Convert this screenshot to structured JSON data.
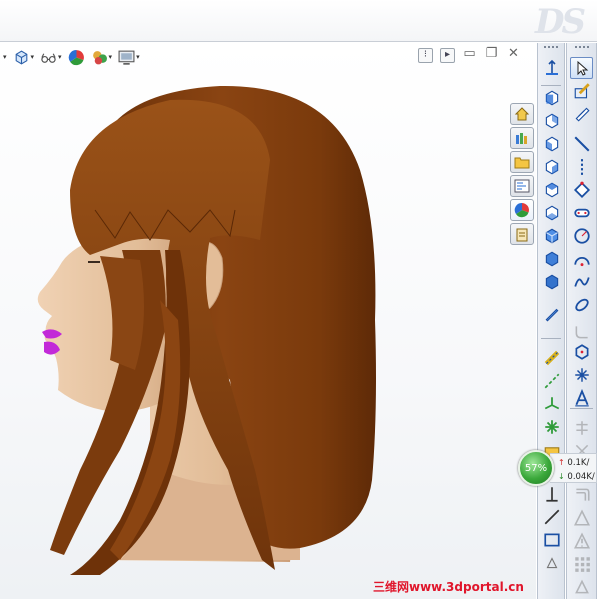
{
  "app": {
    "logo_text": "DS"
  },
  "hud_toolbar": {
    "buttons": [
      {
        "name": "view-orientation",
        "icon": "cube-icon"
      },
      {
        "name": "hide-show-items",
        "icon": "glasses-icon"
      },
      {
        "name": "edit-appearance",
        "icon": "color-wheel-icon"
      },
      {
        "name": "apply-scene",
        "icon": "scene-icon"
      },
      {
        "name": "view-settings",
        "icon": "monitor-icon"
      }
    ]
  },
  "network_monitor": {
    "percent": "57%",
    "upload": "0.1K/",
    "download": "0.04K/"
  },
  "watermark": "三维网www.3dportal.cn",
  "colors": {
    "hair": "#7a3a0c",
    "skin": "#e6c2a0",
    "lips": "#c22ad8",
    "accent_blue": "#2a6fd6",
    "watermark_red": "#e0162b"
  }
}
